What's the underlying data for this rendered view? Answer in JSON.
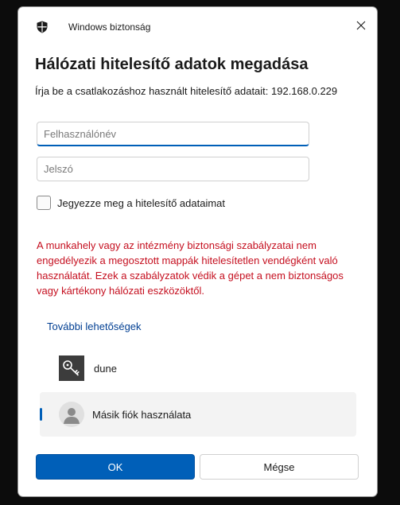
{
  "window": {
    "title": "Windows biztonság",
    "icon": "shield-icon",
    "close_icon": "close-icon"
  },
  "dialog": {
    "heading": "Hálózati hitelesítő adatok megadása",
    "instruction": "Írja be a csatlakozáshoz használt hitelesítő adatait: 192.168.0.229"
  },
  "fields": {
    "username_placeholder": "Felhasználónév",
    "username_value": "",
    "password_placeholder": "Jelszó",
    "password_value": ""
  },
  "remember": {
    "label": "Jegyezze meg a hitelesítő adataimat",
    "checked": false
  },
  "warning": {
    "text": "A munkahely vagy az intézmény biztonsági szabályzatai nem engedélyezik a megosztott mappák hitelesítetlen vendégként való használatát. Ezek a szabályzatok védik a gépet a nem biztonságos vagy kártékony hálózati eszközöktől.",
    "color": "#c50f1f"
  },
  "more_options": {
    "label": "További lehetőségek"
  },
  "accounts": [
    {
      "name": "dune",
      "icon": "key-icon",
      "selected": false
    },
    {
      "name": "Másik fiók használata",
      "icon": "user-avatar-icon",
      "selected": true
    }
  ],
  "buttons": {
    "ok_label": "OK",
    "cancel_label": "Mégse"
  },
  "colors": {
    "accent": "#005fb8",
    "link": "#003e92",
    "selected_row_bg": "#f3f3f3"
  }
}
